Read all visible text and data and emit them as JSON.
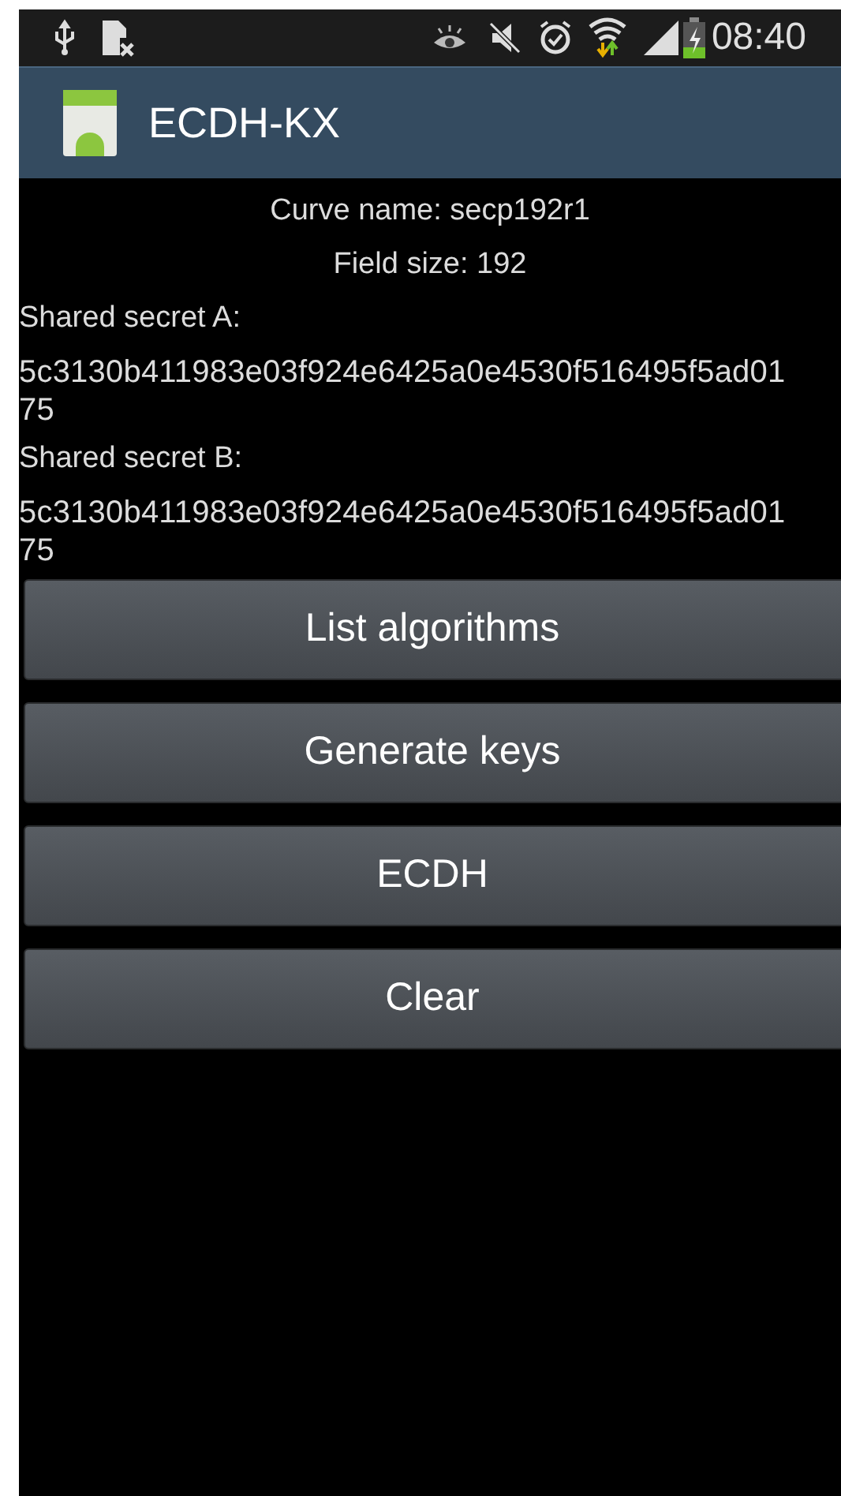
{
  "status_bar": {
    "time": "08:40"
  },
  "action_bar": {
    "title": "ECDH-KX"
  },
  "content": {
    "curve": "Curve name: secp192r1",
    "field_size": "Field size: 192",
    "secrets": [
      {
        "label": "Shared secret A:",
        "lines": [
          "5c3130b411983e03f924e6425a0e4530f516495f5ad01",
          "75"
        ]
      },
      {
        "label": "Shared secret B:",
        "lines": [
          "5c3130b411983e03f924e6425a0e4530f516495f5ad01",
          "75"
        ]
      }
    ]
  },
  "buttons": [
    "List algorithms",
    "Generate keys",
    "ECDH",
    "Clear"
  ]
}
